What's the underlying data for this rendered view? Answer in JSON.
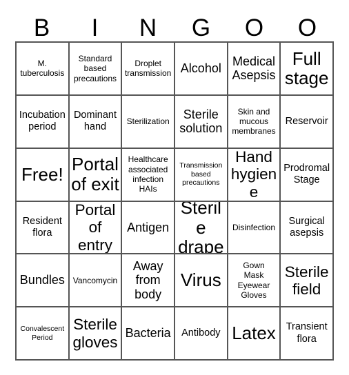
{
  "card": {
    "title": "BINGOO",
    "columns": 6,
    "rows": 6,
    "border_color": "#555555",
    "background_color": "#ffffff",
    "text_color": "#000000"
  },
  "header": {
    "letters": [
      "B",
      "I",
      "N",
      "G",
      "O",
      "O"
    ]
  },
  "grid": {
    "cells": [
      {
        "text": "M.\ntuberculosis",
        "size": "fs-s"
      },
      {
        "text": "Standard\nbased\nprecautions",
        "size": "fs-s"
      },
      {
        "text": "Droplet\ntransmission",
        "size": "fs-s"
      },
      {
        "text": "Alcohol",
        "size": "fs-l"
      },
      {
        "text": "Medical\nAsepsis",
        "size": "fs-l"
      },
      {
        "text": "Full\nstage",
        "size": "fs-xxl"
      },
      {
        "text": "Incubation\nperiod",
        "size": "fs-m"
      },
      {
        "text": "Dominant\nhand",
        "size": "fs-m"
      },
      {
        "text": "Sterilization",
        "size": "fs-s"
      },
      {
        "text": "Sterile\nsolution",
        "size": "fs-l"
      },
      {
        "text": "Skin and\nmucous\nmembranes",
        "size": "fs-s"
      },
      {
        "text": "Reservoir",
        "size": "fs-m"
      },
      {
        "text": "Free!",
        "size": "fs-xxl"
      },
      {
        "text": "Portal\nof exit",
        "size": "fs-xxl"
      },
      {
        "text": "Healthcare\nassociated\ninfection\nHAIs",
        "size": "fs-s"
      },
      {
        "text": "Transmission\nbased\nprecautions",
        "size": "fs-xs"
      },
      {
        "text": "Hand\nhygiene",
        "size": "fs-xl"
      },
      {
        "text": "Prodromal\nStage",
        "size": "fs-m"
      },
      {
        "text": "Resident\nflora",
        "size": "fs-m"
      },
      {
        "text": "Portal\nof entry",
        "size": "fs-xl"
      },
      {
        "text": "Antigen",
        "size": "fs-l"
      },
      {
        "text": "Sterile\ndrape",
        "size": "fs-xxl"
      },
      {
        "text": "Disinfection",
        "size": "fs-s"
      },
      {
        "text": "Surgical\nasepsis",
        "size": "fs-m"
      },
      {
        "text": "Bundles",
        "size": "fs-l"
      },
      {
        "text": "Vancomycin",
        "size": "fs-s"
      },
      {
        "text": "Away\nfrom\nbody",
        "size": "fs-l"
      },
      {
        "text": "Virus",
        "size": "fs-xxl"
      },
      {
        "text": "Gown\nMask\nEyewear\nGloves",
        "size": "fs-s"
      },
      {
        "text": "Sterile\nfield",
        "size": "fs-xl"
      },
      {
        "text": "Convalescent\nPeriod",
        "size": "fs-xs"
      },
      {
        "text": "Sterile\ngloves",
        "size": "fs-xl"
      },
      {
        "text": "Bacteria",
        "size": "fs-l"
      },
      {
        "text": "Antibody",
        "size": "fs-m"
      },
      {
        "text": "Latex",
        "size": "fs-xxl"
      },
      {
        "text": "Transient\nflora",
        "size": "fs-m"
      }
    ]
  }
}
